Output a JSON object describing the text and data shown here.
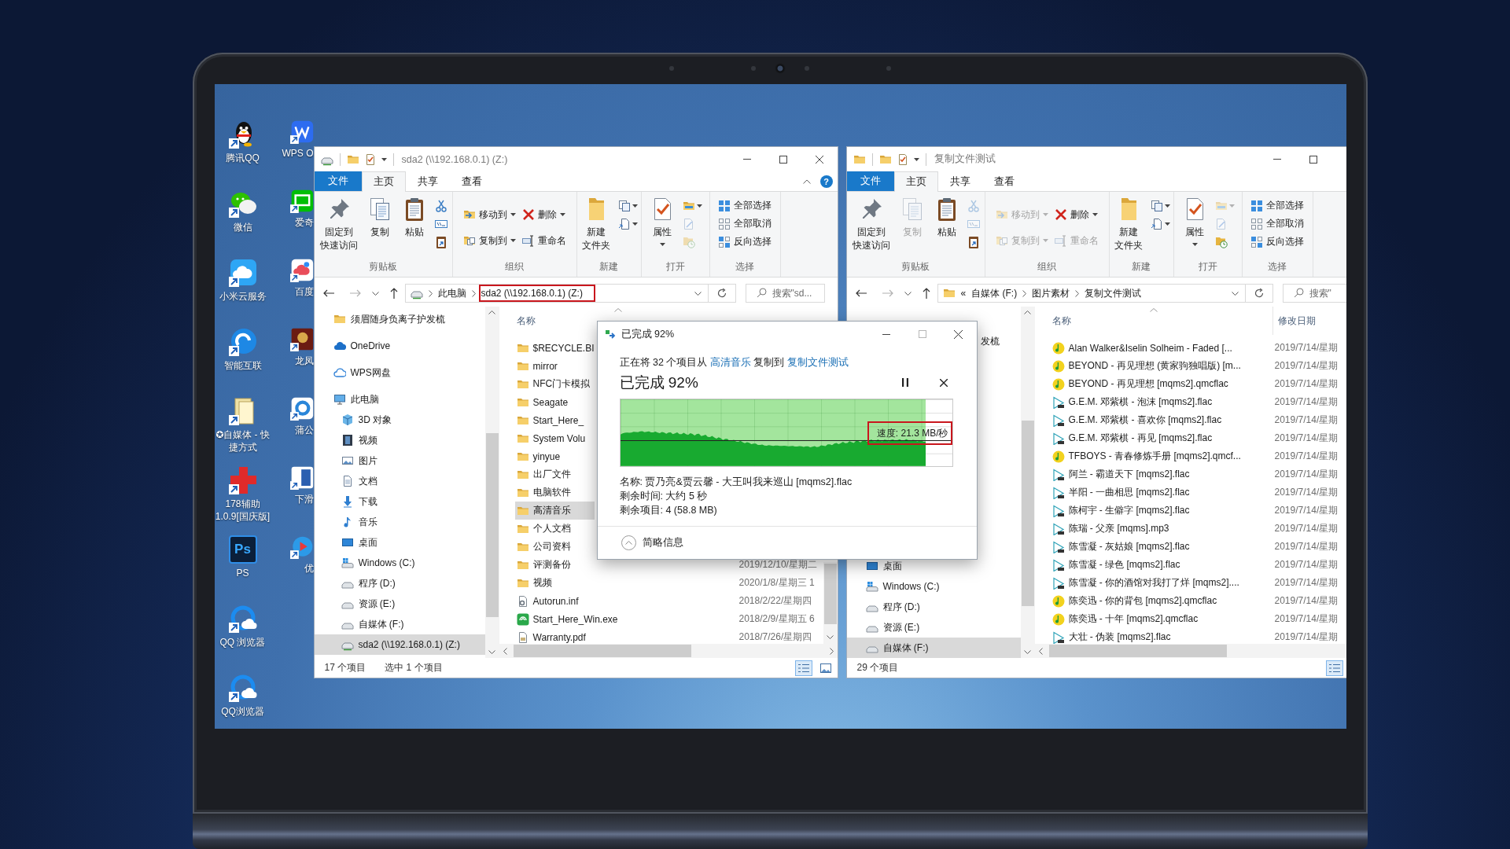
{
  "desktop": {
    "columns": [
      [
        {
          "label": "腾讯QQ"
        },
        {
          "label": "微信"
        },
        {
          "label": "小米云服务"
        },
        {
          "label": "智能互联"
        },
        {
          "label": "✪自媒体 - 快捷方式"
        },
        {
          "label": "178辅助1.0.9[国庆版]"
        },
        {
          "label": "PS",
          "logo_text": "Ps"
        },
        {
          "label": "QQ 浏览器"
        },
        {
          "label": "QQ浏览器"
        }
      ],
      [
        {
          "label": "WPS O"
        },
        {
          "label": "爱奇"
        },
        {
          "label": "百度"
        },
        {
          "label": "龙凤"
        },
        {
          "label": "蒲公"
        },
        {
          "label": "下滑"
        },
        {
          "label": "优"
        }
      ]
    ]
  },
  "windows": [
    {
      "kind": "drive",
      "offscreen_right": false,
      "title": "sda2 (\\\\192.168.0.1) (Z:)",
      "tabs": [
        {
          "label": "文件",
          "kind": "menu",
          "selected": false
        },
        {
          "label": "主页",
          "kind": "tab",
          "selected": true
        },
        {
          "label": "共享",
          "kind": "tab",
          "selected": false
        },
        {
          "label": "查看",
          "kind": "tab",
          "selected": false
        }
      ],
      "help_label": "?",
      "ribbon": [
        {
          "label": "剪贴板",
          "columns": [
            [
              {
                "kind": "large",
                "lines": [
                  "固定到",
                  "快速访问"
                ],
                "disabled": false,
                "dropdown": false
              }
            ],
            [
              {
                "kind": "large",
                "lines": [
                  "复制"
                ],
                "disabled": false,
                "dropdown": false
              }
            ],
            [
              {
                "kind": "large",
                "lines": [
                  "粘贴"
                ],
                "disabled": false,
                "dropdown": false
              }
            ],
            [
              {
                "kind": "icon",
                "disabled": false,
                "dropdown": false
              },
              {
                "kind": "icon",
                "disabled": false,
                "dropdown": false
              },
              {
                "kind": "icon",
                "disabled": false,
                "dropdown": false
              }
            ]
          ]
        },
        {
          "label": "组织",
          "columns": [
            [
              {
                "kind": "small",
                "label": "移动到",
                "disabled": false,
                "dropdown": true
              },
              {
                "kind": "small",
                "label": "复制到",
                "disabled": false,
                "dropdown": true
              }
            ],
            [
              {
                "kind": "small",
                "label": "删除",
                "disabled": false,
                "dropdown": true
              },
              {
                "kind": "small",
                "label": "重命名",
                "disabled": false,
                "dropdown": false
              }
            ]
          ]
        },
        {
          "label": "新建",
          "columns": [
            [
              {
                "kind": "large",
                "lines": [
                  "新建",
                  "文件夹"
                ],
                "disabled": false,
                "dropdown": false
              }
            ],
            [
              {
                "kind": "icon",
                "disabled": false,
                "dropdown": true
              },
              {
                "kind": "icon",
                "disabled": false,
                "dropdown": true
              }
            ]
          ]
        },
        {
          "label": "打开",
          "columns": [
            [
              {
                "kind": "large",
                "lines": [
                  "属性"
                ],
                "disabled": false,
                "dropdown": true
              }
            ],
            [
              {
                "kind": "icon",
                "disabled": false,
                "dropdown": true
              },
              {
                "kind": "icon",
                "disabled": true,
                "dropdown": false
              },
              {
                "kind": "icon",
                "disabled": true,
                "dropdown": false
              }
            ]
          ]
        },
        {
          "label": "选择",
          "columns": [
            [
              {
                "kind": "small",
                "label": "全部选择",
                "disabled": false,
                "dropdown": false
              },
              {
                "kind": "small",
                "label": "全部取消",
                "disabled": false,
                "dropdown": false
              },
              {
                "kind": "small",
                "label": "反向选择",
                "disabled": false,
                "dropdown": false
              }
            ]
          ]
        }
      ],
      "back_disabled": false,
      "forward_disabled": true,
      "address": {
        "crumbs": [
          {
            "label": "此电脑",
            "highlighted": false
          },
          {
            "label": "sda2 (\\\\192.168.0.1) (Z:)",
            "highlighted": true
          }
        ]
      },
      "search": {
        "placeholder": "搜索\"sd..."
      },
      "nav": [
        {
          "label": "须眉随身负离子护发梳",
          "kind": "folder",
          "selected": false
        },
        {
          "label": "OneDrive",
          "kind": "onedrive",
          "selected": false
        },
        {
          "label": "WPS网盘",
          "kind": "cloud",
          "selected": false
        },
        {
          "label": "此电脑",
          "kind": "computer",
          "selected": false,
          "children": [
            {
              "label": "3D 对象",
              "kind": "objects",
              "selected": false
            },
            {
              "label": "视频",
              "kind": "videos",
              "selected": false
            },
            {
              "label": "图片",
              "kind": "pictures",
              "selected": false
            },
            {
              "label": "文档",
              "kind": "documents",
              "selected": false
            },
            {
              "label": "下载",
              "kind": "downloads",
              "selected": false
            },
            {
              "label": "音乐",
              "kind": "music",
              "selected": false
            },
            {
              "label": "桌面",
              "kind": "desktop",
              "selected": false
            },
            {
              "label": "Windows (C:)",
              "kind": "system_drive",
              "selected": false
            },
            {
              "label": "程序 (D:)",
              "kind": "drive",
              "selected": false
            },
            {
              "label": "资源 (E:)",
              "kind": "drive",
              "selected": false
            },
            {
              "label": "自媒体 (F:)",
              "kind": "drive",
              "selected": false
            },
            {
              "label": "sda2 (\\\\192.168.0.1) (Z:)",
              "kind": "network_drive",
              "selected": true
            }
          ]
        }
      ],
      "list": {
        "columns": [
          {
            "label": "名称",
            "sorted": true
          }
        ],
        "rows": [
          {
            "name": "$RECYCLE.BI",
            "kind": "folder",
            "selected": false
          },
          {
            "name": "mirror",
            "kind": "folder",
            "selected": false
          },
          {
            "name": "NFC门卡模拟",
            "kind": "folder",
            "selected": false
          },
          {
            "name": "Seagate",
            "kind": "folder",
            "selected": false
          },
          {
            "name": "Start_Here_",
            "kind": "folder",
            "selected": false
          },
          {
            "name": "System Volu",
            "kind": "folder",
            "selected": false
          },
          {
            "name": "yinyue",
            "kind": "folder",
            "selected": false
          },
          {
            "name": "出厂文件",
            "kind": "folder",
            "selected": false
          },
          {
            "name": "电脑软件",
            "kind": "folder",
            "selected": false
          },
          {
            "name": "高清音乐",
            "kind": "folder",
            "selected": true
          },
          {
            "name": "个人文档",
            "kind": "folder",
            "selected": false
          },
          {
            "name": "公司资料",
            "kind": "folder",
            "selected": false
          },
          {
            "name": "评测备份",
            "kind": "folder",
            "date": "2019/12/10/星期二",
            "selected": false
          },
          {
            "name": "视频",
            "kind": "folder",
            "date": "2020/1/8/星期三 1",
            "selected": false
          },
          {
            "name": "Autorun.inf",
            "kind": "settings_file",
            "date": "2018/2/22/星期四",
            "selected": false
          },
          {
            "name": "Start_Here_Win.exe",
            "kind": "app",
            "date": "2018/2/9/星期五 6",
            "selected": false
          },
          {
            "name": "Warranty.pdf",
            "kind": "document",
            "date": "2018/7/26/星期四",
            "selected": false
          }
        ]
      },
      "status": [
        "17 个项目",
        "选中 1 个项目"
      ],
      "views": [
        {
          "selected": true
        },
        {
          "selected": false
        }
      ]
    },
    {
      "kind": "folder",
      "offscreen_right": true,
      "title": "复制文件测试",
      "tabs": [
        {
          "label": "文件",
          "kind": "menu",
          "selected": false
        },
        {
          "label": "主页",
          "kind": "tab",
          "selected": true
        },
        {
          "label": "共享",
          "kind": "tab",
          "selected": false
        },
        {
          "label": "查看",
          "kind": "tab",
          "selected": false
        }
      ],
      "ribbon": [
        {
          "label": "剪贴板",
          "columns": [
            [
              {
                "kind": "large",
                "lines": [
                  "固定到",
                  "快速访问"
                ],
                "disabled": false,
                "dropdown": false
              }
            ],
            [
              {
                "kind": "large",
                "lines": [
                  "复制"
                ],
                "disabled": true,
                "dropdown": false
              }
            ],
            [
              {
                "kind": "large",
                "lines": [
                  "粘贴"
                ],
                "disabled": false,
                "dropdown": false
              }
            ],
            [
              {
                "kind": "icon",
                "disabled": true,
                "dropdown": false
              },
              {
                "kind": "icon",
                "disabled": true,
                "dropdown": false
              },
              {
                "kind": "icon",
                "disabled": false,
                "dropdown": false
              }
            ]
          ]
        },
        {
          "label": "组织",
          "columns": [
            [
              {
                "kind": "small",
                "label": "移动到",
                "disabled": true,
                "dropdown": true
              },
              {
                "kind": "small",
                "label": "复制到",
                "disabled": true,
                "dropdown": true
              }
            ],
            [
              {
                "kind": "small",
                "label": "删除",
                "disabled": false,
                "dropdown": true
              },
              {
                "kind": "small",
                "label": "重命名",
                "disabled": true,
                "dropdown": false
              }
            ]
          ]
        },
        {
          "label": "新建",
          "columns": [
            [
              {
                "kind": "large",
                "lines": [
                  "新建",
                  "文件夹"
                ],
                "disabled": false,
                "dropdown": false
              }
            ],
            [
              {
                "kind": "icon",
                "disabled": false,
                "dropdown": true
              },
              {
                "kind": "icon",
                "disabled": false,
                "dropdown": true
              }
            ]
          ]
        },
        {
          "label": "打开",
          "columns": [
            [
              {
                "kind": "large",
                "lines": [
                  "属性"
                ],
                "disabled": false,
                "dropdown": true
              }
            ],
            [
              {
                "kind": "icon",
                "disabled": true,
                "dropdown": true
              },
              {
                "kind": "icon",
                "disabled": true,
                "dropdown": false
              },
              {
                "kind": "icon",
                "disabled": false,
                "dropdown": false
              }
            ]
          ]
        },
        {
          "label": "选择",
          "columns": [
            [
              {
                "kind": "small",
                "label": "全部选择",
                "disabled": false,
                "dropdown": false
              },
              {
                "kind": "small",
                "label": "全部取消",
                "disabled": false,
                "dropdown": false
              },
              {
                "kind": "small",
                "label": "反向选择",
                "disabled": false,
                "dropdown": false
              }
            ]
          ]
        }
      ],
      "back_disabled": false,
      "forward_disabled": true,
      "address": {
        "overflow": "«",
        "crumbs": [
          {
            "label": "自媒体 (F:)",
            "highlighted": false
          },
          {
            "label": "图片素材",
            "highlighted": false
          },
          {
            "label": "复制文件测试",
            "highlighted": false
          }
        ]
      },
      "search": {
        "placeholder": "搜索\""
      },
      "nav": [
        {
          "label": "发梳",
          "kind": "clipped",
          "selected": false
        },
        {
          "label": "桌面",
          "kind": "desktop",
          "selected": false
        },
        {
          "label": "Windows (C:)",
          "kind": "system_drive",
          "selected": false
        },
        {
          "label": "程序 (D:)",
          "kind": "drive",
          "selected": false
        },
        {
          "label": "资源 (E:)",
          "kind": "drive",
          "selected": false
        },
        {
          "label": "自媒体 (F:)",
          "kind": "drive",
          "selected": true
        }
      ],
      "list": {
        "columns": [
          {
            "label": "名称",
            "sorted": true
          },
          {
            "label": "修改日期",
            "sorted": false
          }
        ],
        "rows": [
          {
            "name": "Alan Walker&Iselin Solheim - Faded [...",
            "kind": "qmc_audio",
            "date": "2019/7/14/星期",
            "selected": false
          },
          {
            "name": "BEYOND - 再见理想 (黄家驹独唱版) [m...",
            "kind": "qmc_audio",
            "date": "2019/7/14/星期",
            "selected": false
          },
          {
            "name": "BEYOND - 再见理想 [mqms2].qmcflac",
            "kind": "qmc_audio",
            "date": "2019/7/14/星期",
            "selected": false
          },
          {
            "name": "G.E.M. 邓紫棋 - 泡沫 [mqms2].flac",
            "kind": "audio",
            "date": "2019/7/14/星期",
            "selected": false
          },
          {
            "name": "G.E.M. 邓紫棋 - 喜欢你 [mqms2].flac",
            "kind": "audio",
            "date": "2019/7/14/星期",
            "selected": false
          },
          {
            "name": "G.E.M. 邓紫棋 - 再见 [mqms2].flac",
            "kind": "audio",
            "date": "2019/7/14/星期",
            "selected": false
          },
          {
            "name": "TFBOYS - 青春修炼手册 [mqms2].qmcf...",
            "kind": "qmc_audio",
            "date": "2019/7/14/星期",
            "selected": false
          },
          {
            "name": "阿兰 - 霸道天下 [mqms2].flac",
            "kind": "audio",
            "date": "2019/7/14/星期",
            "selected": false
          },
          {
            "name": "半阳 - 一曲相思 [mqms2].flac",
            "kind": "audio",
            "date": "2019/7/14/星期",
            "selected": false
          },
          {
            "name": "陈柯宇 - 生僻字 [mqms2].flac",
            "kind": "audio",
            "date": "2019/7/14/星期",
            "selected": false
          },
          {
            "name": "陈瑞 - 父亲 [mqms].mp3",
            "kind": "audio",
            "date": "2019/7/14/星期",
            "selected": false
          },
          {
            "name": "陈雪凝 - 灰姑娘 [mqms2].flac",
            "kind": "audio",
            "date": "2019/7/14/星期",
            "selected": false
          },
          {
            "name": "陈雪凝 - 绿色 [mqms2].flac",
            "kind": "audio",
            "date": "2019/7/14/星期",
            "selected": false
          },
          {
            "name": "陈雪凝 - 你的酒馆对我打了烊 [mqms2]....",
            "kind": "audio",
            "date": "2019/7/14/星期",
            "selected": false
          },
          {
            "name": "陈奕迅 - 你的背包 [mqms2].qmcflac",
            "kind": "qmc_audio",
            "date": "2019/7/14/星期",
            "selected": false
          },
          {
            "name": "陈奕迅 - 十年 [mqms2].qmcflac",
            "kind": "qmc_audio",
            "date": "2019/7/14/星期",
            "selected": false
          },
          {
            "name": "大壮 - 伪装 [mqms2].flac",
            "kind": "audio",
            "date": "2019/7/14/星期",
            "selected": false
          }
        ]
      },
      "status": [
        "29 个项目"
      ],
      "views": [
        {
          "selected": true
        }
      ]
    }
  ],
  "copy_dialog": {
    "title": "已完成 92%",
    "maximize_disabled": true,
    "status": {
      "prefix": "正在将 32 个项目从",
      "source": "高清音乐",
      "middle": "复制到",
      "destination": "复制文件测试"
    },
    "heading": "已完成 92%",
    "progress": {
      "level": 0.92
    },
    "speed": {
      "label": "速度: 21.3 MB/秒",
      "highlighted": true
    },
    "details": [
      "名称: 贾乃亮&贾云馨 - 大王叫我来巡山 [mqms2].flac",
      "剩余时间: 大约 5 秒",
      "剩余项目: 4 (58.8 MB)"
    ],
    "toggle": "简略信息"
  }
}
